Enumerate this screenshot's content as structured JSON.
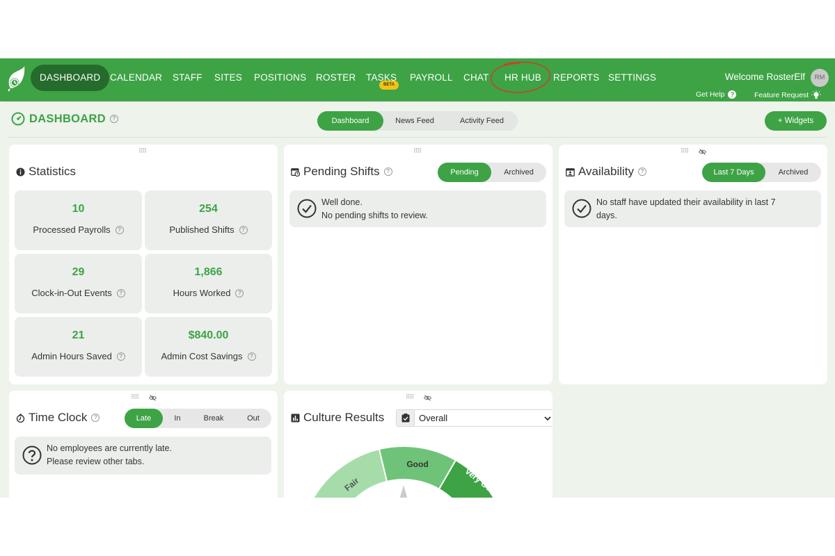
{
  "nav": {
    "items": [
      {
        "label": "DASHBOARD"
      },
      {
        "label": "CALENDAR"
      },
      {
        "label": "STAFF"
      },
      {
        "label": "SITES"
      },
      {
        "label": "POSITIONS"
      },
      {
        "label": "ROSTER"
      },
      {
        "label": "TASKS"
      },
      {
        "label": "PAYROLL"
      },
      {
        "label": "CHAT"
      },
      {
        "label": "HR HUB"
      },
      {
        "label": "REPORTS"
      },
      {
        "label": "SETTINGS"
      }
    ],
    "beta_badge": "BETA",
    "welcome": "Welcome RosterElf",
    "avatar_initials": "RM",
    "get_help": "Get Help",
    "help_glyph": "?",
    "feature_request": "Feature Request",
    "accent_color": "#3da345",
    "active_color": "#256b2c"
  },
  "page": {
    "title": "DASHBOARD",
    "tabs": [
      {
        "label": "Dashboard"
      },
      {
        "label": "News Feed"
      },
      {
        "label": "Activity Feed"
      }
    ],
    "widgets_button": "+ Widgets"
  },
  "statistics": {
    "title": "Statistics",
    "items": [
      {
        "value": "10",
        "label": "Processed Payrolls"
      },
      {
        "value": "254",
        "label": "Published Shifts"
      },
      {
        "value": "29",
        "label": "Clock-in-Out Events"
      },
      {
        "value": "1,866",
        "label": "Hours Worked"
      },
      {
        "value": "21",
        "label": "Admin Hours Saved"
      },
      {
        "value": "$840.00",
        "label": "Admin Cost Savings"
      }
    ]
  },
  "pending_shifts": {
    "title": "Pending Shifts",
    "tabs": [
      "Pending",
      "Archived"
    ],
    "message_line1": "Well done.",
    "message_line2": "No pending shifts to review."
  },
  "availability": {
    "title": "Availability",
    "tabs": [
      "Last 7 Days",
      "Archived"
    ],
    "message_line1": "No staff have updated their availability in last 7",
    "message_line2": "days."
  },
  "time_clock": {
    "title": "Time Clock",
    "tabs": [
      "Late",
      "In",
      "Break",
      "Out"
    ],
    "message_line1": "No employees are currently late.",
    "message_line2": "Please review other tabs."
  },
  "culture": {
    "title": "Culture Results",
    "select_value": "Overall",
    "gauge_labels": [
      "Fair",
      "Good",
      "Very Good"
    ]
  },
  "icons": {
    "drag_handle": "drag-handle-icon",
    "eye_off": "eye-off-icon",
    "help": "help-circle-icon",
    "check": "check-circle-icon"
  }
}
